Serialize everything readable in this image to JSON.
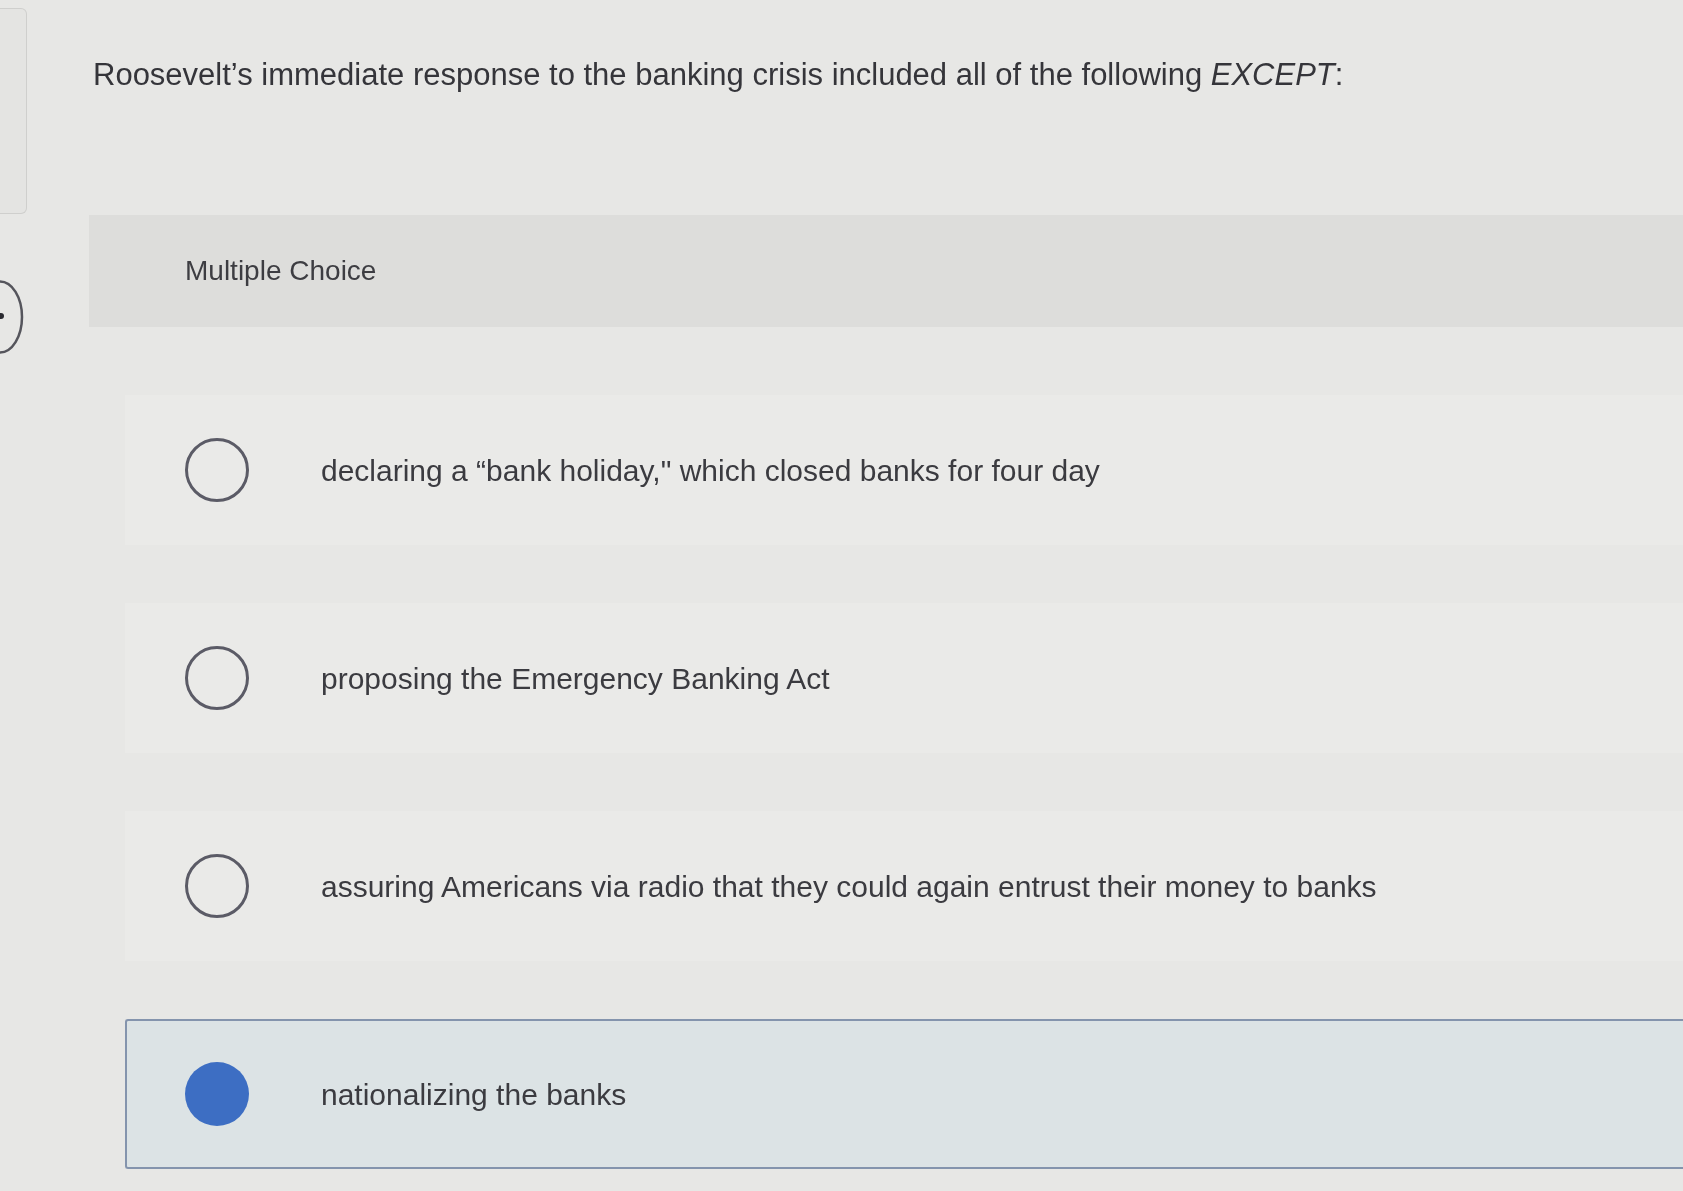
{
  "question": {
    "text": "Roosevelt’s immediate response to the banking crisis included all of the following *EXCEPT*:"
  },
  "question_type": "Multiple Choice",
  "choices": [
    {
      "text": "declaring a “bank holiday,\" which closed banks for four day",
      "selected": false
    },
    {
      "text": "proposing the Emergency Banking Act",
      "selected": false
    },
    {
      "text": "assuring Americans via radio that they could again entrust their money to banks",
      "selected": false
    },
    {
      "text": "nationalizing the banks",
      "selected": true
    }
  ]
}
